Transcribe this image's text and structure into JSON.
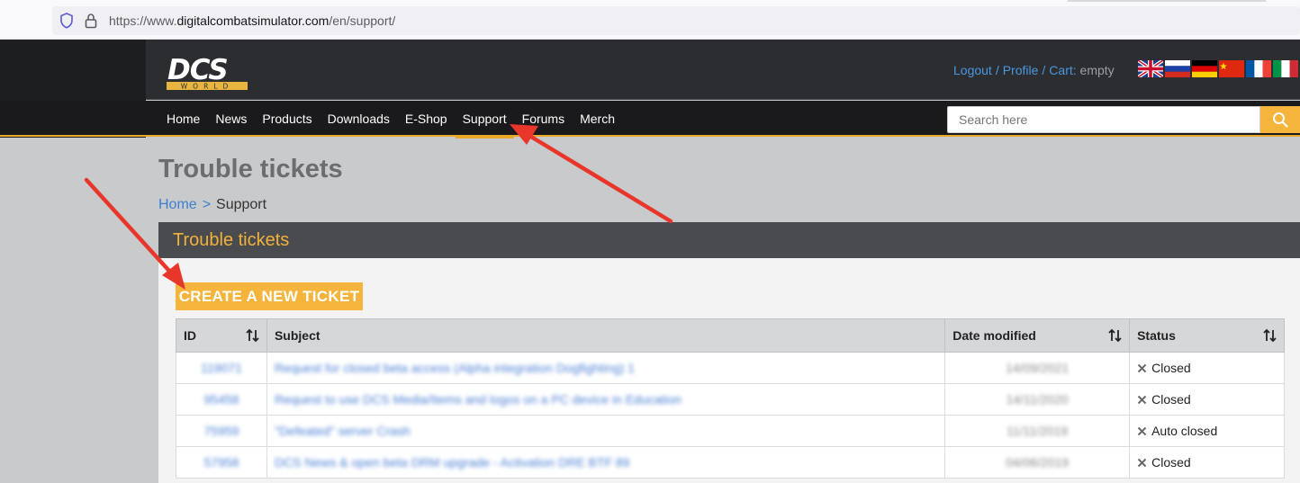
{
  "browser": {
    "url_prefix": "https://www.",
    "url_host": "digitalcombatsimulator.com",
    "url_path": "/en/support/",
    "icons": [
      "shield-icon",
      "lock-icon"
    ]
  },
  "header": {
    "logo_text": "DCS",
    "logo_sub": "WORLD",
    "logout": "Logout",
    "profile": "Profile",
    "cart_label": "Cart:",
    "cart_value": "empty",
    "separator": "/",
    "flags": [
      "flag-uk-icon",
      "flag-ru-icon",
      "flag-de-icon",
      "flag-cn-icon",
      "flag-fr-icon",
      "flag-it-icon"
    ]
  },
  "nav": {
    "items": [
      "Home",
      "News",
      "Products",
      "Downloads",
      "E-Shop",
      "Support",
      "Forums",
      "Merch"
    ],
    "active": "Support",
    "search_placeholder": "Search here"
  },
  "page": {
    "title": "Trouble tickets",
    "breadcrumb_home": "Home",
    "breadcrumb_sep": ">",
    "breadcrumb_current": "Support",
    "section_title": "Trouble tickets",
    "create_button": "CREATE A NEW TICKET"
  },
  "table": {
    "headers": {
      "id": "ID",
      "subject": "Subject",
      "date": "Date modified",
      "status": "Status"
    },
    "rows": [
      {
        "id": "119071",
        "subject": "Request for closed beta access (Alpha integration Dogfighting) 1",
        "date": "14/09/2021",
        "status": "Closed"
      },
      {
        "id": "95458",
        "subject": "Request to use DCS Media/Items and logos on a PC device in Education",
        "date": "14/11/2020",
        "status": "Closed"
      },
      {
        "id": "75959",
        "subject": "\"Defeated\" server Crash",
        "date": "11/11/2019",
        "status": "Auto closed"
      },
      {
        "id": "57958",
        "subject": "DCS News & open beta DRM upgrade - Activation DRE BTF 89",
        "date": "04/06/2019",
        "status": "Closed"
      }
    ]
  },
  "colors": {
    "accent": "#f5b43c",
    "header_bg": "#2c2d30",
    "nav_bg": "#1a1a1c",
    "link": "#3f7fd0",
    "annotation_arrow": "#e8362b"
  }
}
